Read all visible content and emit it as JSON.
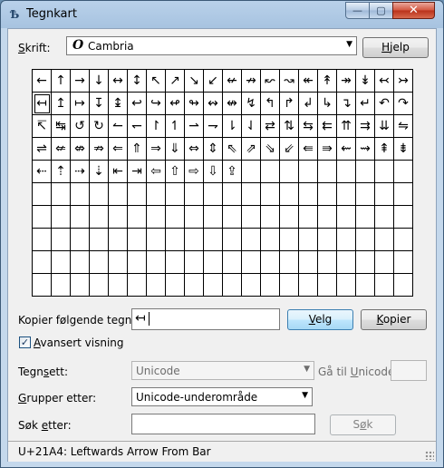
{
  "window": {
    "title": "Tegnkart",
    "icon_name": "charmap-app-icon",
    "controls": {
      "minimize": "—",
      "maximize": "▢",
      "close": "✕"
    }
  },
  "font_row": {
    "label_underline": "S",
    "label_rest": "krift:",
    "font_glyph": "O",
    "font_name": "Cambria",
    "help_underline": "H",
    "help_rest": "jelp"
  },
  "characters": [
    "←",
    "↑",
    "→",
    "↓",
    "↔",
    "↕",
    "↖",
    "↗",
    "↘",
    "↙",
    "↚",
    "↛",
    "↜",
    "↝",
    "↞",
    "↟",
    "↠",
    "↡",
    "↢",
    "↣",
    "↤",
    "↥",
    "↦",
    "↧",
    "↨",
    "↩",
    "↪",
    "↫",
    "↬",
    "↭",
    "↮",
    "↯",
    "↰",
    "↱",
    "↲",
    "↳",
    "↴",
    "↵",
    "↶",
    "↷",
    "↸",
    "↹",
    "↺",
    "↻",
    "↼",
    "↽",
    "↾",
    "↿",
    "⇀",
    "⇁",
    "⇂",
    "⇃",
    "⇄",
    "⇅",
    "⇆",
    "⇇",
    "⇈",
    "⇉",
    "⇊",
    "⇋",
    "⇌",
    "⇍",
    "⇎",
    "⇏",
    "⇐",
    "⇑",
    "⇒",
    "⇓",
    "⇔",
    "⇕",
    "⇖",
    "⇗",
    "⇘",
    "⇙",
    "⇚",
    "⇛",
    "⇜",
    "⇝",
    "⇞",
    "⇟",
    "⇠",
    "⇡",
    "⇢",
    "⇣",
    "⇤",
    "⇥",
    "⇦",
    "⇧",
    "⇨",
    "⇩",
    "⇪"
  ],
  "total_cells": 200,
  "selected_index": 20,
  "copy_row": {
    "label_pre": "Kopier følgende tegn:",
    "value": "↤",
    "select_underline": "V",
    "select_rest": "elg",
    "copy_underline": "K",
    "copy_rest": "opier"
  },
  "advanced": {
    "checked": true,
    "check_glyph": "✓",
    "label_underline": "A",
    "label_rest": "vansert visning"
  },
  "charset": {
    "label_pre": "Tegn",
    "label_underline": "s",
    "label_post": "ett:",
    "value": "Unicode",
    "goto_pre": "Gå til ",
    "goto_underline": "U",
    "goto_post": "nicode:"
  },
  "group": {
    "label_underline": "G",
    "label_rest": "rupper etter:",
    "value": "Unicode-underområde"
  },
  "search": {
    "label_pre": "Søk ",
    "label_underline": "e",
    "label_post": "tter:",
    "button_pre": "S",
    "button_underline": "ø",
    "button_post": "k"
  },
  "status": {
    "text": "U+21A4: Leftwards Arrow From Bar"
  }
}
